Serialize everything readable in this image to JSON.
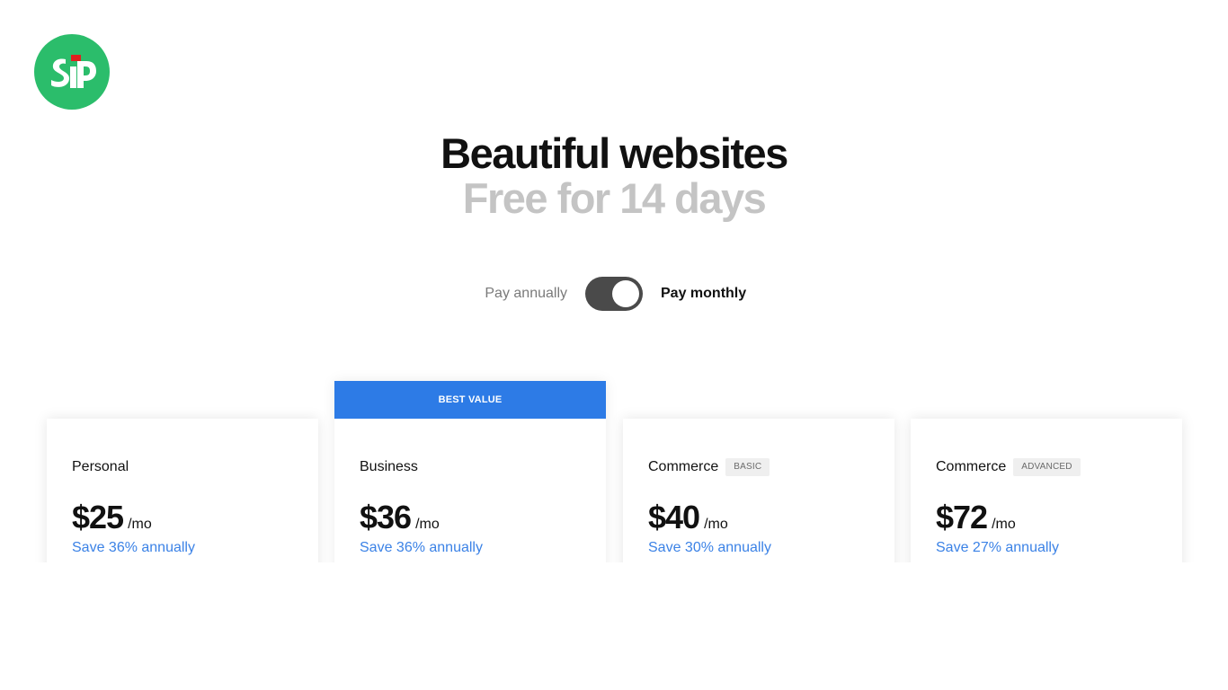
{
  "logo": {
    "text": "SP",
    "colors": {
      "circle": "#2bbd6b",
      "letters": "#ffffff",
      "accent": "#e0201f"
    }
  },
  "hero": {
    "title": "Beautiful websites",
    "subtitle": "Free for 14 days"
  },
  "billing": {
    "annual_label": "Pay annually",
    "monthly_label": "Pay monthly",
    "selected": "monthly"
  },
  "plans": [
    {
      "name": "Personal",
      "tag": "",
      "price": "$25",
      "per": "/mo",
      "save": "Save 36% annually",
      "banner": ""
    },
    {
      "name": "Business",
      "tag": "",
      "price": "$36",
      "per": "/mo",
      "save": "Save 36% annually",
      "banner": "BEST VALUE"
    },
    {
      "name": "Commerce",
      "tag": "BASIC",
      "price": "$40",
      "per": "/mo",
      "save": "Save 30% annually",
      "banner": ""
    },
    {
      "name": "Commerce",
      "tag": "ADVANCED",
      "price": "$72",
      "per": "/mo",
      "save": "Save 27% annually",
      "banner": ""
    }
  ],
  "colors": {
    "accent": "#2d7be6",
    "save_link": "#3b82e6",
    "toggle_track": "#4a4a4a",
    "subtitle_gray": "#c4c4c4"
  }
}
